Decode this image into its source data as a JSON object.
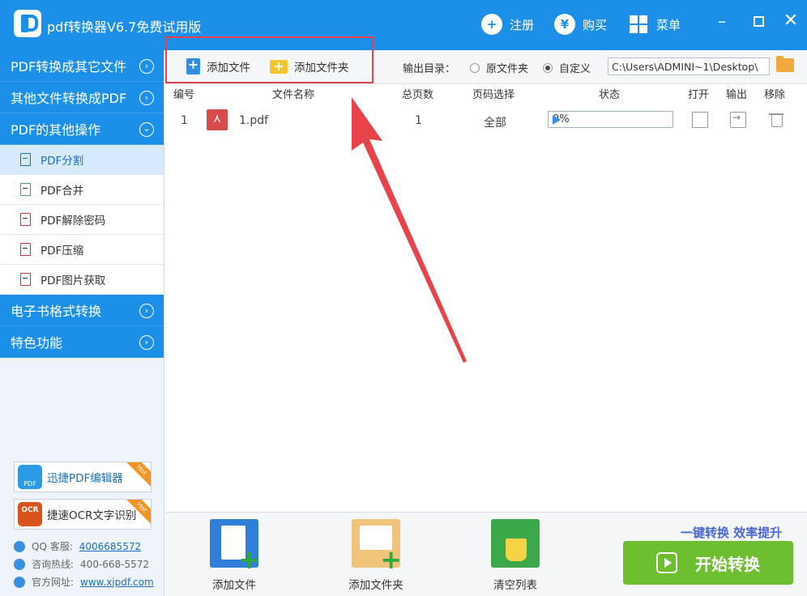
{
  "app": {
    "title": "pdf转换器V6.7免费试用版",
    "register_label": "注册",
    "buy_label": "购买",
    "menu_label": "菜单",
    "register_icon": "user-plus-icon",
    "buy_icon": "yen-icon",
    "accent": "#1c8fe8"
  },
  "sidebar": {
    "categories": [
      {
        "label": "PDF转换成其它文件"
      },
      {
        "label": "其他文件转换成PDF"
      },
      {
        "label": "PDF的其他操作"
      },
      {
        "label": "电子书格式转换"
      },
      {
        "label": "特色功能"
      }
    ],
    "sub_items": [
      {
        "label": "PDF分割"
      },
      {
        "label": "PDF合并"
      },
      {
        "label": "PDF解除密码"
      },
      {
        "label": "PDF压缩"
      },
      {
        "label": "PDF图片获取"
      }
    ],
    "promos": [
      {
        "label": "迅捷PDF编辑器",
        "badge": "Hot",
        "icon_text": "PDF"
      },
      {
        "label": "捷速OCR文字识别",
        "badge": "Hot",
        "icon_text": "OCR"
      }
    ],
    "contact": {
      "qq_label": "QQ 客服:",
      "qq_value": "4006685572",
      "hotline_label": "咨询热线:",
      "hotline_value": "400-668-5572",
      "site_label": "官方网址:",
      "site_value": "www.xjpdf.com"
    }
  },
  "toolbar": {
    "add_file": "添加文件",
    "add_folder": "添加文件夹",
    "output_label": "输出目录：",
    "radio_original": "原文件夹",
    "radio_custom": "自定义",
    "path_value": "C:\\Users\\ADMINI~1\\Desktop\\",
    "highlight_color": "#e8424a"
  },
  "table": {
    "headers": {
      "index": "编号",
      "name": "文件名称",
      "pages": "总页数",
      "range": "页码选择",
      "status": "状态",
      "open": "打开",
      "output": "输出",
      "remove": "移除"
    },
    "rows": [
      {
        "index": "1",
        "name": "1.pdf",
        "pages": "1",
        "range": "全部",
        "progress": "0%"
      }
    ]
  },
  "bottom": {
    "add_file": "添加文件",
    "add_folder": "添加文件夹",
    "clear_list": "清空列表",
    "slogan": "一键转换  效率提升",
    "start": "开始转换",
    "start_color": "#6dbf30"
  }
}
